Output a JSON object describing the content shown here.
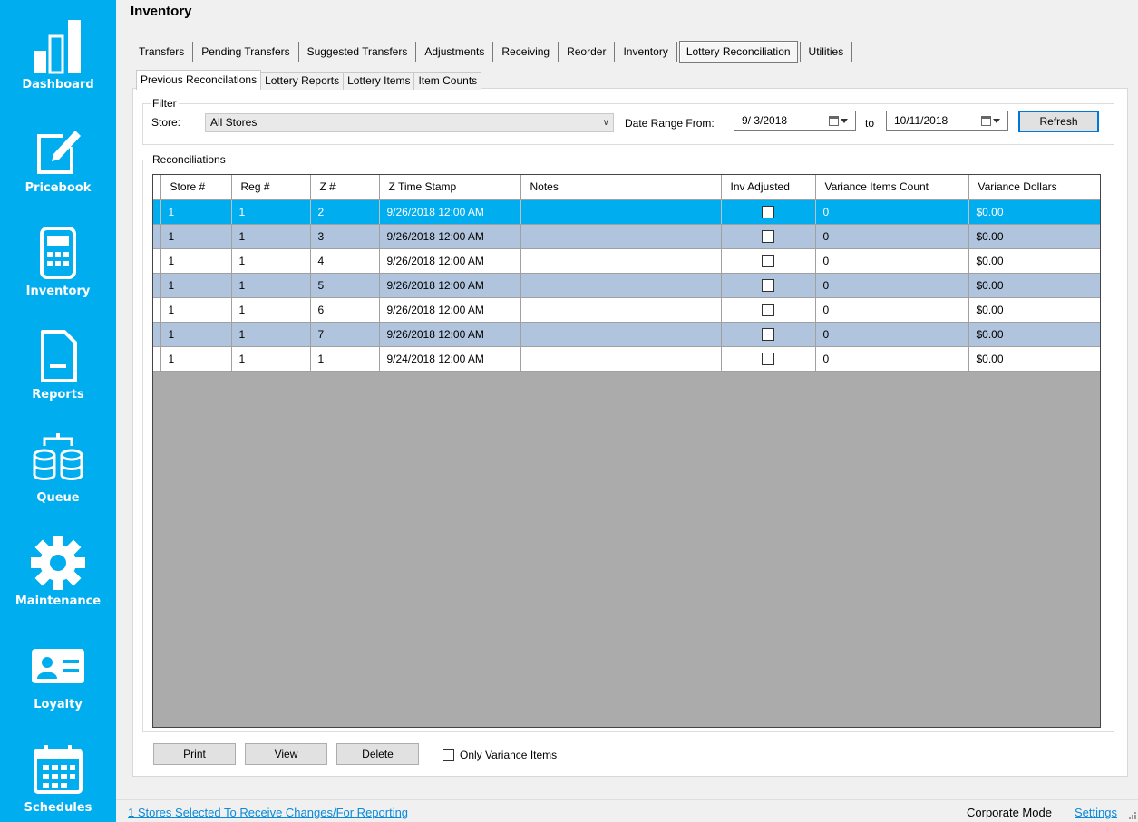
{
  "colors": {
    "sidebar": "#00adef",
    "selected_row": "#00adef",
    "alt_row": "#b0c4de",
    "grid_bg": "#ababab",
    "link": "#0a8ad8"
  },
  "sidebar": {
    "items": [
      {
        "label": "Dashboard",
        "icon": "bar-chart-icon"
      },
      {
        "label": "Pricebook",
        "icon": "edit-document-icon"
      },
      {
        "label": "Inventory",
        "icon": "calculator-icon"
      },
      {
        "label": "Reports",
        "icon": "report-document-icon"
      },
      {
        "label": "Queue",
        "icon": "database-queue-icon"
      },
      {
        "label": "Maintenance",
        "icon": "gear-icon"
      },
      {
        "label": "Loyalty",
        "icon": "id-card-icon"
      },
      {
        "label": "Schedules",
        "icon": "calendar-icon"
      }
    ]
  },
  "page": {
    "title": "Inventory"
  },
  "main_tabs": [
    "Transfers",
    "Pending Transfers",
    "Suggested Transfers",
    "Adjustments",
    "Receiving",
    "Reorder",
    "Inventory",
    "Lottery Reconciliation",
    "Utilities"
  ],
  "active_main_tab": "Lottery Reconciliation",
  "sub_tabs": [
    "Previous Reconcilations",
    "Lottery Reports",
    "Lottery Items",
    "Item Counts"
  ],
  "active_sub_tab": "Previous Reconcilations",
  "filter": {
    "legend": "Filter",
    "store_label": "Store:",
    "store_value": "All Stores",
    "date_range_label": "Date Range From:",
    "from_date": "9/ 3/2018",
    "to_label": "to",
    "to_date": "10/11/2018",
    "refresh_label": "Refresh"
  },
  "reconciliations": {
    "legend": "Reconciliations",
    "columns": [
      "Store #",
      "Reg #",
      "Z #",
      "Z Time Stamp",
      "Notes",
      "Inv Adjusted",
      "Variance Items Count",
      "Variance Dollars"
    ],
    "rows": [
      {
        "store": "1",
        "reg": "1",
        "z": "2",
        "timestamp": "9/26/2018 12:00 AM",
        "notes": "",
        "inv_adjusted": false,
        "variance_count": "0",
        "variance_dollars": "$0.00"
      },
      {
        "store": "1",
        "reg": "1",
        "z": "3",
        "timestamp": "9/26/2018 12:00 AM",
        "notes": "",
        "inv_adjusted": false,
        "variance_count": "0",
        "variance_dollars": "$0.00"
      },
      {
        "store": "1",
        "reg": "1",
        "z": "4",
        "timestamp": "9/26/2018 12:00 AM",
        "notes": "",
        "inv_adjusted": false,
        "variance_count": "0",
        "variance_dollars": "$0.00"
      },
      {
        "store": "1",
        "reg": "1",
        "z": "5",
        "timestamp": "9/26/2018 12:00 AM",
        "notes": "",
        "inv_adjusted": false,
        "variance_count": "0",
        "variance_dollars": "$0.00"
      },
      {
        "store": "1",
        "reg": "1",
        "z": "6",
        "timestamp": "9/26/2018 12:00 AM",
        "notes": "",
        "inv_adjusted": false,
        "variance_count": "0",
        "variance_dollars": "$0.00"
      },
      {
        "store": "1",
        "reg": "1",
        "z": "7",
        "timestamp": "9/26/2018 12:00 AM",
        "notes": "",
        "inv_adjusted": false,
        "variance_count": "0",
        "variance_dollars": "$0.00"
      },
      {
        "store": "1",
        "reg": "1",
        "z": "1",
        "timestamp": "9/24/2018 12:00 AM",
        "notes": "",
        "inv_adjusted": false,
        "variance_count": "0",
        "variance_dollars": "$0.00"
      }
    ]
  },
  "actions": {
    "print": "Print",
    "view": "View",
    "delete": "Delete",
    "only_variance": "Only Variance Items"
  },
  "status_bar": {
    "stores_link": "1 Stores Selected To Receive Changes/For Reporting",
    "mode": "Corporate Mode",
    "settings_link": "Settings"
  }
}
